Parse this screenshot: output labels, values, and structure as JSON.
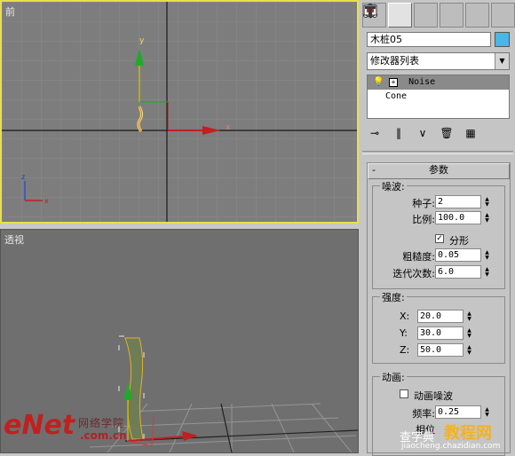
{
  "viewports": {
    "front_label": "前",
    "persp_label": "透视"
  },
  "gizmo": {
    "x": "x",
    "y": "y",
    "z": "z"
  },
  "command_panel": {
    "tabs": [
      "create-icon",
      "modify-icon",
      "hierarchy-icon",
      "motion-icon",
      "display-icon",
      "utilities-icon"
    ],
    "object_name": "木桩05",
    "object_color": "#49b7e2",
    "modifier_list": "修改器列表",
    "stack": [
      {
        "label": "Noise",
        "selected": true
      },
      {
        "label": "Cone",
        "selected": false
      }
    ],
    "tools": [
      "pin-stack-icon",
      "show-end-result-icon",
      "make-unique-icon",
      "remove-modifier-icon",
      "configure-sets-icon"
    ]
  },
  "params": {
    "title": "参数",
    "noise_group": "噪波:",
    "seed_label": "种子:",
    "seed_value": "2",
    "scale_label": "比例:",
    "scale_value": "100.0",
    "fractal_label": "分形",
    "fractal_checked": true,
    "roughness_label": "粗糙度:",
    "roughness_value": "0.05",
    "iterations_label": "迭代次数:",
    "iterations_value": "6.0",
    "strength_group": "强度:",
    "x_label": "X:",
    "x_value": "20.0",
    "y_label": "Y:",
    "y_value": "30.0",
    "z_label": "Z:",
    "z_value": "50.0",
    "anim_group": "动画:",
    "anim_noise_label": "动画噪波",
    "anim_noise_checked": false,
    "freq_label": "频率:",
    "freq_value": "0.25",
    "phase_label": "相位"
  },
  "watermark": {
    "enet": "eNet",
    "enet_cn": "网络学院",
    "enet_url": ".com.cn",
    "site_cn": "查字典",
    "site_url": "jiaocheng.chazidian.com",
    "site_badge": "教程网"
  }
}
